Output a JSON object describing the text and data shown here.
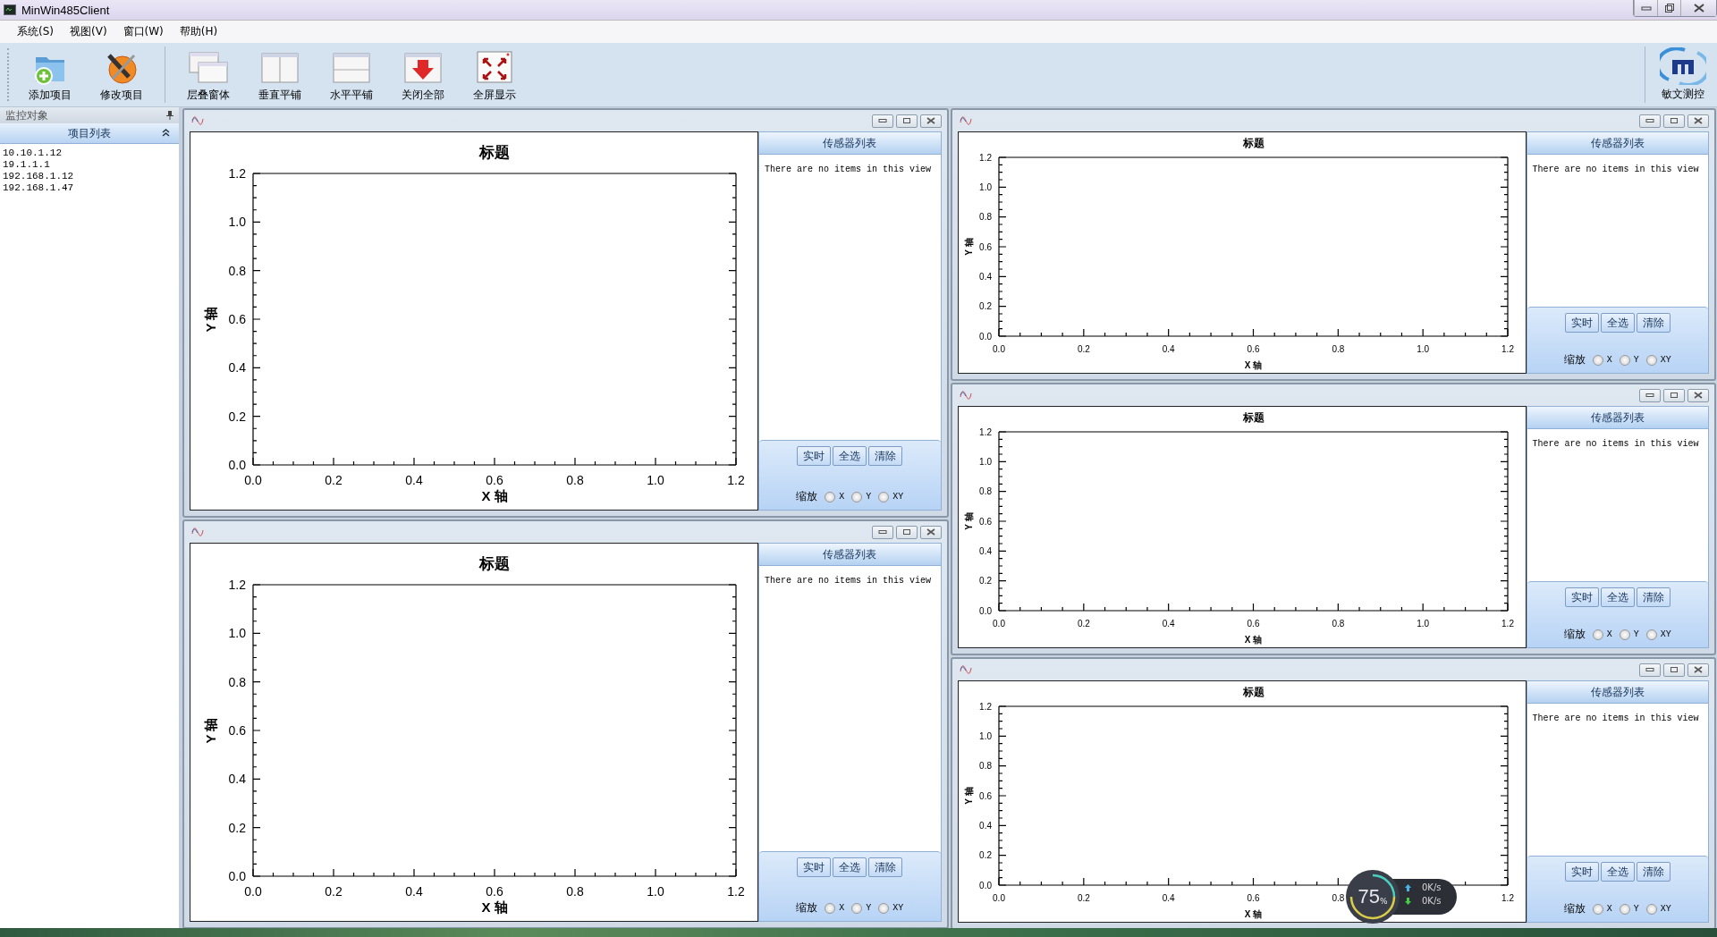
{
  "window": {
    "title": "MinWin485Client"
  },
  "menu": [
    "系统(S)",
    "视图(V)",
    "窗口(W)",
    "帮助(H)"
  ],
  "toolbar": {
    "groups": [
      [
        {
          "kind": "add",
          "label": "添加项目"
        },
        {
          "kind": "edit",
          "label": "修改项目"
        }
      ],
      [
        {
          "kind": "cascade",
          "label": "层叠窗体"
        },
        {
          "kind": "tile_v",
          "label": "垂直平铺"
        },
        {
          "kind": "tile_h",
          "label": "水平平铺"
        },
        {
          "kind": "close_all",
          "label": "关闭全部"
        },
        {
          "kind": "fullscreen",
          "label": "全屏显示"
        }
      ]
    ],
    "logo": {
      "label": "敏文测控"
    }
  },
  "sidebar": {
    "title": "监控对象",
    "section": {
      "title": "项目列表",
      "expanded": true,
      "items": [
        "10.10.1.12",
        "19.1.1.1",
        "192.168.1.12",
        "192.168.1.47"
      ]
    }
  },
  "left_column": [
    {
      "chart_data": {
        "type": "line",
        "title": "标题",
        "xlabel": "X 轴",
        "ylabel": "Y 轴",
        "xlim": [
          0,
          1.2
        ],
        "ylim": [
          0,
          1.2
        ],
        "xticks": [
          {
            "value": 0,
            "label": "0.0"
          },
          {
            "value": 0.2,
            "label": "0.2"
          },
          {
            "value": 0.4,
            "label": "0.4"
          },
          {
            "value": 0.6,
            "label": "0.6"
          },
          {
            "value": 0.8,
            "label": "0.8"
          },
          {
            "value": 1,
            "label": "1.0"
          },
          {
            "value": 1.2,
            "label": "1.2"
          }
        ],
        "yticks": [
          {
            "value": 0,
            "label": "0.0"
          },
          {
            "value": 0.2,
            "label": "0.2"
          },
          {
            "value": 0.4,
            "label": "0.4"
          },
          {
            "value": 0.6,
            "label": "0.6"
          },
          {
            "value": 0.8,
            "label": "0.8"
          },
          {
            "value": 1,
            "label": "1.0"
          },
          {
            "value": 1.2,
            "label": "1.2"
          }
        ]
      },
      "sensor_panel": {
        "title": "传感器列表",
        "empty_text": "There are no items in this view",
        "buttons": [
          "实时",
          "全选",
          "清除"
        ],
        "zoom_label": "缩放",
        "zoom_options": [
          {
            "label": "X",
            "selected": false
          },
          {
            "label": "Y",
            "selected": false
          },
          {
            "label": "XY",
            "selected": false
          }
        ]
      }
    },
    {
      "chart_data": {
        "type": "line",
        "title": "标题",
        "xlabel": "X 轴",
        "ylabel": "Y 轴",
        "xlim": [
          0,
          1.2
        ],
        "ylim": [
          0,
          1.2
        ],
        "xticks": [
          {
            "value": 0,
            "label": "0.0"
          },
          {
            "value": 0.2,
            "label": "0.2"
          },
          {
            "value": 0.4,
            "label": "0.4"
          },
          {
            "value": 0.6,
            "label": "0.6"
          },
          {
            "value": 0.8,
            "label": "0.8"
          },
          {
            "value": 1,
            "label": "1.0"
          },
          {
            "value": 1.2,
            "label": "1.2"
          }
        ],
        "yticks": [
          {
            "value": 0,
            "label": "0.0"
          },
          {
            "value": 0.2,
            "label": "0.2"
          },
          {
            "value": 0.4,
            "label": "0.4"
          },
          {
            "value": 0.6,
            "label": "0.6"
          },
          {
            "value": 0.8,
            "label": "0.8"
          },
          {
            "value": 1,
            "label": "1.0"
          },
          {
            "value": 1.2,
            "label": "1.2"
          }
        ]
      },
      "sensor_panel": {
        "title": "传感器列表",
        "empty_text": "There are no items in this view",
        "buttons": [
          "实时",
          "全选",
          "清除"
        ],
        "zoom_label": "缩放",
        "zoom_options": [
          {
            "label": "X",
            "selected": false
          },
          {
            "label": "Y",
            "selected": false
          },
          {
            "label": "XY",
            "selected": false
          }
        ]
      }
    }
  ],
  "right_column": [
    {
      "chart_data": {
        "type": "line",
        "title": "标题",
        "xlabel": "X 轴",
        "ylabel": "Y 轴",
        "xlim": [
          0,
          1.2
        ],
        "ylim": [
          0,
          1.2
        ],
        "xticks": [
          {
            "value": 0,
            "label": "0.0"
          },
          {
            "value": 0.2,
            "label": "0.2"
          },
          {
            "value": 0.4,
            "label": "0.4"
          },
          {
            "value": 0.6,
            "label": "0.6"
          },
          {
            "value": 0.8,
            "label": "0.8"
          },
          {
            "value": 1,
            "label": "1.0"
          },
          {
            "value": 1.2,
            "label": "1.2"
          }
        ],
        "yticks": [
          {
            "value": 0,
            "label": "0.0"
          },
          {
            "value": 0.2,
            "label": "0.2"
          },
          {
            "value": 0.4,
            "label": "0.4"
          },
          {
            "value": 0.6,
            "label": "0.6"
          },
          {
            "value": 0.8,
            "label": "0.8"
          },
          {
            "value": 1,
            "label": "1.0"
          },
          {
            "value": 1.2,
            "label": "1.2"
          }
        ]
      },
      "sensor_panel": {
        "title": "传感器列表",
        "empty_text": "There are no items in this view",
        "buttons": [
          "实时",
          "全选",
          "清除"
        ],
        "zoom_label": "缩放",
        "zoom_options": [
          {
            "label": "X",
            "selected": false
          },
          {
            "label": "Y",
            "selected": false
          },
          {
            "label": "XY",
            "selected": false
          }
        ]
      }
    },
    {
      "chart_data": {
        "type": "line",
        "title": "标题",
        "xlabel": "X 轴",
        "ylabel": "Y 轴",
        "xlim": [
          0,
          1.2
        ],
        "ylim": [
          0,
          1.2
        ],
        "xticks": [
          {
            "value": 0,
            "label": "0.0"
          },
          {
            "value": 0.2,
            "label": "0.2"
          },
          {
            "value": 0.4,
            "label": "0.4"
          },
          {
            "value": 0.6,
            "label": "0.6"
          },
          {
            "value": 0.8,
            "label": "0.8"
          },
          {
            "value": 1,
            "label": "1.0"
          },
          {
            "value": 1.2,
            "label": "1.2"
          }
        ],
        "yticks": [
          {
            "value": 0,
            "label": "0.0"
          },
          {
            "value": 0.2,
            "label": "0.2"
          },
          {
            "value": 0.4,
            "label": "0.4"
          },
          {
            "value": 0.6,
            "label": "0.6"
          },
          {
            "value": 0.8,
            "label": "0.8"
          },
          {
            "value": 1,
            "label": "1.0"
          },
          {
            "value": 1.2,
            "label": "1.2"
          }
        ]
      },
      "sensor_panel": {
        "title": "传感器列表",
        "empty_text": "There are no items in this view",
        "buttons": [
          "实时",
          "全选",
          "清除"
        ],
        "zoom_label": "缩放",
        "zoom_options": [
          {
            "label": "X",
            "selected": false
          },
          {
            "label": "Y",
            "selected": false
          },
          {
            "label": "XY",
            "selected": false
          }
        ]
      }
    },
    {
      "chart_data": {
        "type": "line",
        "title": "标题",
        "xlabel": "X 轴",
        "ylabel": "Y 轴",
        "xlim": [
          0,
          1.2
        ],
        "ylim": [
          0,
          1.2
        ],
        "xticks": [
          {
            "value": 0,
            "label": "0.0"
          },
          {
            "value": 0.2,
            "label": "0.2"
          },
          {
            "value": 0.4,
            "label": "0.4"
          },
          {
            "value": 0.6,
            "label": "0.6"
          },
          {
            "value": 0.8,
            "label": "0.8"
          },
          {
            "value": 1.2,
            "label": "1.2"
          }
        ],
        "yticks": [
          {
            "value": 0,
            "label": "0.0"
          },
          {
            "value": 0.2,
            "label": "0.2"
          },
          {
            "value": 0.4,
            "label": "0.4"
          },
          {
            "value": 0.6,
            "label": "0.6"
          },
          {
            "value": 0.8,
            "label": "0.8"
          },
          {
            "value": 1,
            "label": "1.0"
          },
          {
            "value": 1.2,
            "label": "1.2"
          }
        ]
      },
      "sensor_panel": {
        "title": "传感器列表",
        "empty_text": "There are no items in this view",
        "buttons": [
          "实时",
          "全选",
          "清除"
        ],
        "zoom_label": "缩放",
        "zoom_options": [
          {
            "label": "X",
            "selected": false
          },
          {
            "label": "Y",
            "selected": false
          },
          {
            "label": "XY",
            "selected": false
          }
        ]
      }
    }
  ],
  "net_monitor": {
    "percent": "75",
    "unit": "%",
    "upload": "0K/s",
    "download": "0K/s"
  }
}
